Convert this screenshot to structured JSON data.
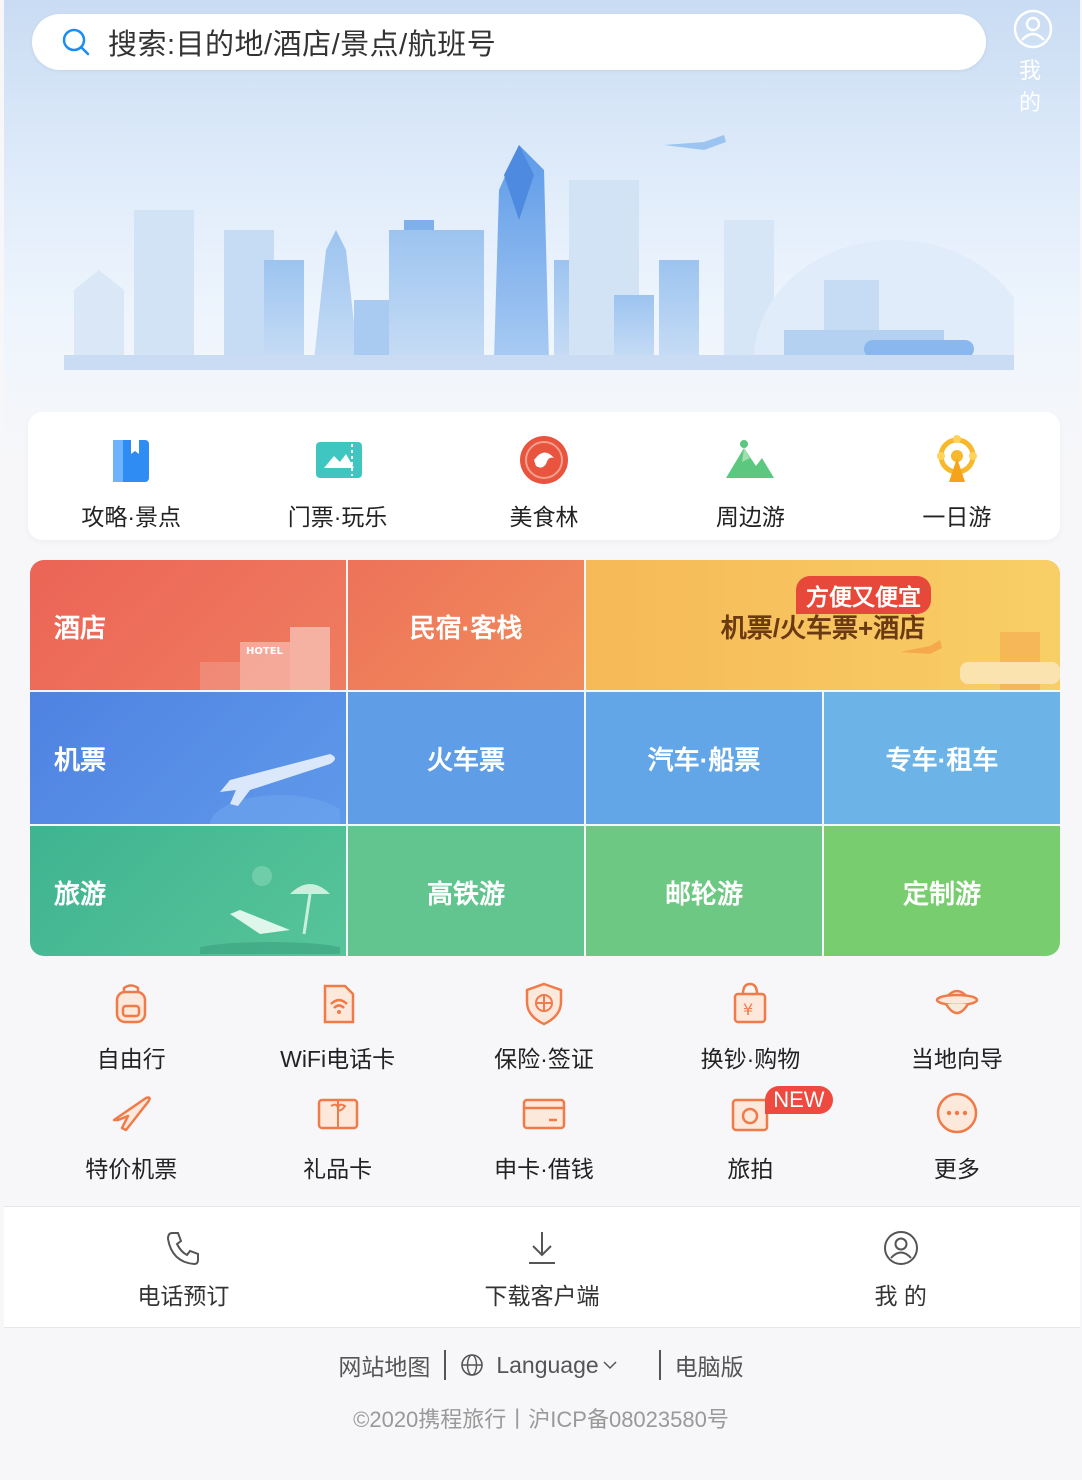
{
  "search": {
    "placeholder": "搜索:目的地/酒店/景点/航班号"
  },
  "top_mine": "我 的",
  "quick": [
    {
      "label": "攻略·景点",
      "icon": "guide-book-icon"
    },
    {
      "label": "门票·玩乐",
      "icon": "ticket-icon"
    },
    {
      "label": "美食林",
      "icon": "food-forest-icon"
    },
    {
      "label": "周边游",
      "icon": "mountain-icon"
    },
    {
      "label": "一日游",
      "icon": "ferris-wheel-icon"
    }
  ],
  "grid": {
    "hotel": "酒店",
    "homestay": "民宿·客栈",
    "package": "机票/火车票+酒店",
    "package_badge": "方便又便宜",
    "flight": "机票",
    "train": "火车票",
    "bus_ship": "汽车·船票",
    "car": "专车·租车",
    "travel": "旅游",
    "hsr_tour": "高铁游",
    "cruise": "邮轮游",
    "custom": "定制游"
  },
  "services": [
    [
      {
        "label": "自由行",
        "icon": "backpack-icon"
      },
      {
        "label": "WiFi电话卡",
        "icon": "wifi-card-icon"
      },
      {
        "label": "保险·签证",
        "icon": "shield-globe-icon"
      },
      {
        "label": "换钞·购物",
        "icon": "shopping-bag-icon"
      },
      {
        "label": "当地向导",
        "icon": "guide-hat-icon"
      }
    ],
    [
      {
        "label": "特价机票",
        "icon": "plane-icon"
      },
      {
        "label": "礼品卡",
        "icon": "gift-card-icon"
      },
      {
        "label": "申卡·借钱",
        "icon": "credit-card-icon"
      },
      {
        "label": "旅拍",
        "icon": "photo-icon",
        "badge": "NEW"
      },
      {
        "label": "更多",
        "icon": "more-icon"
      }
    ]
  ],
  "bottom": [
    {
      "label": "电话预订",
      "icon": "phone-icon"
    },
    {
      "label": "下载客户端",
      "icon": "download-icon"
    },
    {
      "label": "我 的",
      "icon": "user-icon"
    }
  ],
  "footer": {
    "sitemap": "网站地图",
    "language": "Language",
    "desktop": "电脑版",
    "copyright": "©2020携程旅行丨沪ICP备08023580号"
  },
  "colors": {
    "accent_orange": "#f08a4b",
    "hotel_red": "#ec6a5a",
    "flight_blue": "#4f8be6",
    "travel_green": "#4dbd8a"
  }
}
